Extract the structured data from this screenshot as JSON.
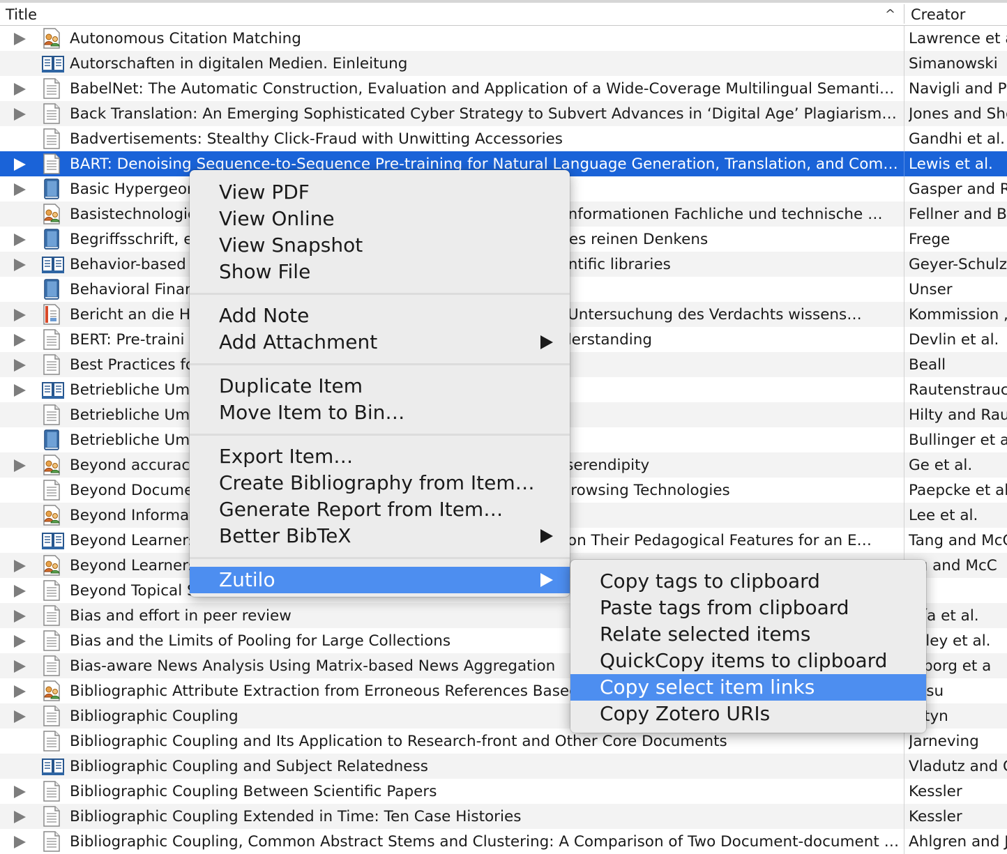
{
  "header": {
    "title": "Title",
    "sort_indicator": "^",
    "creator": "Creator"
  },
  "rows": [
    {
      "title": "Autonomous Citation Matching",
      "creator": "Lawrence et a",
      "icon": "conference-paper",
      "expand": true
    },
    {
      "title": "Autorschaften in digitalen Medien. Einleitung",
      "creator": "Simanowski",
      "icon": "book-section",
      "expand": false
    },
    {
      "title": "BabelNet: The Automatic Construction, Evaluation and Application of a Wide-Coverage Multilingual Semantic …",
      "creator": "Navigli and Po",
      "icon": "journal-article",
      "expand": true
    },
    {
      "title": "Back Translation: An Emerging Sophisticated Cyber Strategy to Subvert Advances in ‘Digital Age’ Plagiarism D…",
      "creator": "Jones and She",
      "icon": "journal-article",
      "expand": true
    },
    {
      "title": "Badvertisements: Stealthy Click-Fraud with Unwitting Accessories",
      "creator": "Gandhi et al.",
      "icon": "journal-article",
      "expand": false
    },
    {
      "title": "BART: Denoising Sequence-to-Sequence Pre-training for Natural Language Generation, Translation, and Com…",
      "creator": "Lewis et al.",
      "icon": "journal-article",
      "expand": true,
      "selected": true
    },
    {
      "title": "Basic Hypergeom",
      "creator": "Gasper and R",
      "icon": "book",
      "expand": true
    },
    {
      "title": "Basistechnologie                                                                         eltinformationen Fachliche und technische …",
      "creator": "Fellner and Bu",
      "icon": "conference-paper",
      "expand": false
    },
    {
      "title": "Begriffsschrift, e                                                                          e des reinen Denkens",
      "creator": "Frege",
      "icon": "book",
      "expand": true
    },
    {
      "title": "Behavior-based                                                                          scientific libraries",
      "creator": "Geyer-Schulz",
      "icon": "book-section",
      "expand": true
    },
    {
      "title": "Behavioral Finan",
      "creator": "Unser",
      "icon": "book",
      "expand": false
    },
    {
      "title": "Bericht an die He                                                                       der Untersuchung des Verdachts wissens…",
      "creator": "Kommission ,",
      "icon": "report",
      "expand": true
    },
    {
      "title": "BERT: Pre-traini                                                                        e Understanding",
      "creator": "Devlin et al.",
      "icon": "journal-article",
      "expand": true
    },
    {
      "title": "Best Practices fo                                                                        s",
      "creator": "Beall",
      "icon": "journal-article",
      "expand": true
    },
    {
      "title": "Betriebliche Umw",
      "creator": "Rautenstrauch",
      "icon": "book-section",
      "expand": true
    },
    {
      "title": "Betriebliche Umw",
      "creator": "Hilty and Rau",
      "icon": "journal-article",
      "expand": false
    },
    {
      "title": "Betriebliche Umw                                                                         k",
      "creator": "Bullinger et a",
      "icon": "book",
      "expand": false
    },
    {
      "title": "Beyond accuracy                                                                          d serendipity",
      "creator": "Ge et al.",
      "icon": "conference-paper",
      "expand": true
    },
    {
      "title": "Beyond Docume                                                                          d Browsing Technologies",
      "creator": "Paepcke et al",
      "icon": "journal-article",
      "expand": false
    },
    {
      "title": "Beyond Informat",
      "creator": "Lee et al.",
      "icon": "conference-paper",
      "expand": false
    },
    {
      "title": "Beyond Learners                                                                         ed on Their Pedagogical Features for an E…",
      "creator": "Tang and McC",
      "icon": "book-section",
      "expand": false
    },
    {
      "title": "Beyond Learners",
      "creator": "ng and McC",
      "icon": "conference-paper",
      "expand": true
    },
    {
      "title": "Beyond Topical S",
      "creator": "an",
      "icon": "journal-article",
      "expand": true
    },
    {
      "title": "Bias and effort in peer review",
      "creator": "rcía et al.",
      "icon": "journal-article",
      "expand": true
    },
    {
      "title": "Bias and the Limits of Pooling for Large Collections",
      "creator": "ckley et al.",
      "icon": "journal-article",
      "expand": true
    },
    {
      "title": "Bias-aware News Analysis Using Matrix-based News Aggregation",
      "creator": "mborg et a",
      "icon": "journal-article",
      "expand": true
    },
    {
      "title": "Bibliographic Attribute Extraction from Erroneous References Based",
      "creator": "kasu",
      "icon": "conference-paper",
      "expand": true
    },
    {
      "title": "Bibliographic Coupling",
      "creator": "artyn",
      "icon": "journal-article",
      "expand": true
    },
    {
      "title": "Bibliographic Coupling and Its Application to Research-front and Other Core Documents",
      "creator": "Jarneving",
      "icon": "journal-article",
      "expand": false
    },
    {
      "title": "Bibliographic Coupling and Subject Relatedness",
      "creator": "Vladutz and C",
      "icon": "book-section",
      "expand": false
    },
    {
      "title": "Bibliographic Coupling Between Scientific Papers",
      "creator": "Kessler",
      "icon": "journal-article",
      "expand": true
    },
    {
      "title": "Bibliographic Coupling Extended in Time: Ten Case Histories",
      "creator": "Kessler",
      "icon": "journal-article",
      "expand": true
    },
    {
      "title": "Bibliographic Coupling, Common Abstract Stems and Clustering: A Comparison of Two Document-document …",
      "creator": "Ahlgren and J",
      "icon": "journal-article",
      "expand": true
    }
  ],
  "context_menu": {
    "groups": [
      [
        "View PDF",
        "View Online",
        "View Snapshot",
        "Show File"
      ],
      [
        "Add Note",
        "Add Attachment"
      ],
      [
        "Duplicate Item",
        "Move Item to Bin…"
      ],
      [
        "Export Item…",
        "Create Bibliography from Item…",
        "Generate Report from Item…",
        "Better BibTeX"
      ],
      [
        "Zutilo"
      ]
    ],
    "submenu_items": [
      "Add Attachment",
      "Better BibTeX",
      "Zutilo"
    ],
    "highlighted": "Zutilo"
  },
  "zutilo_submenu": {
    "items": [
      "Copy tags to clipboard",
      "Paste tags from clipboard",
      "Relate selected items",
      "QuickCopy items to clipboard",
      "Copy select item links",
      "Copy Zotero URIs"
    ],
    "highlighted": "Copy select item links"
  },
  "colors": {
    "selection": "#1a63d8",
    "menu_highlight": "#4d8ef0",
    "menu_bg": "#ececec"
  }
}
